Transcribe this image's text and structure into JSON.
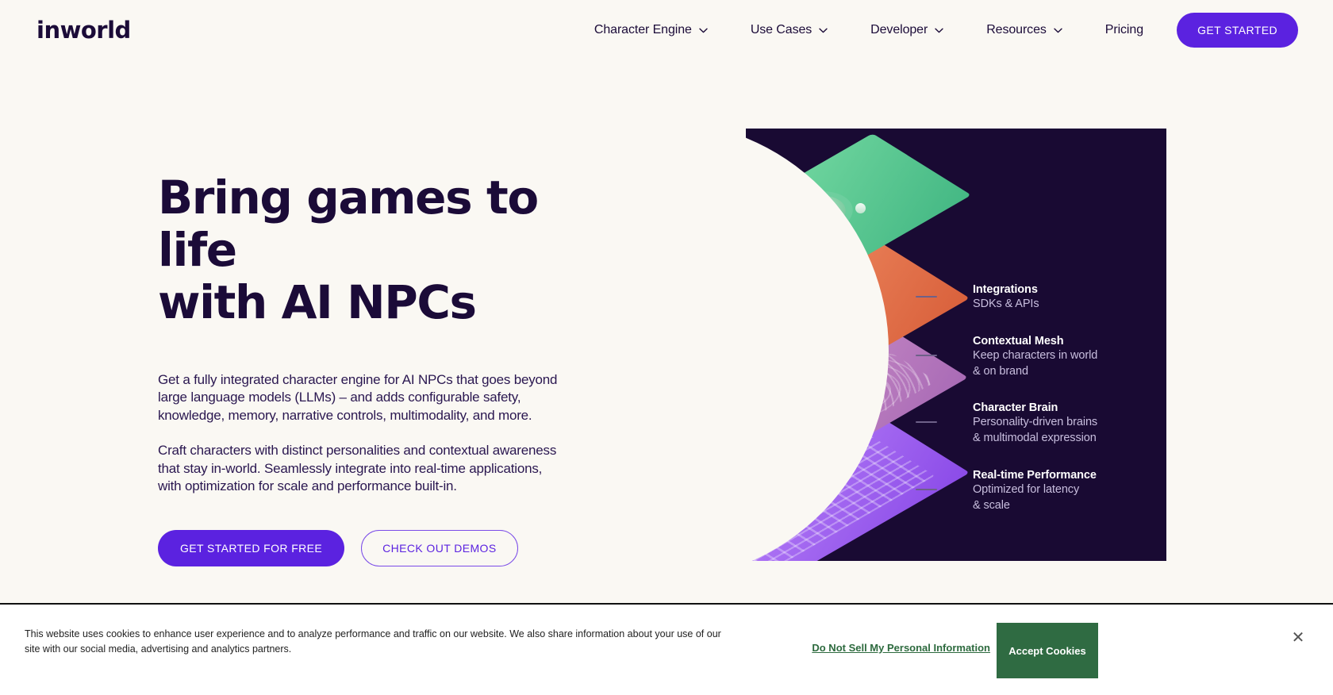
{
  "brand": {
    "logo_text": "inworld",
    "accent": "#5B22E0",
    "dark": "#1B0B38",
    "bg": "#FAF8F3"
  },
  "header": {
    "nav": [
      {
        "label": "Character Engine",
        "has_dropdown": true,
        "icon": "chevron-down-icon"
      },
      {
        "label": "Use Cases",
        "has_dropdown": true,
        "icon": "chevron-down-icon"
      },
      {
        "label": "Developer",
        "has_dropdown": true,
        "icon": "chevron-down-icon"
      },
      {
        "label": "Resources",
        "has_dropdown": true,
        "icon": "chevron-down-icon"
      },
      {
        "label": "Pricing",
        "has_dropdown": false,
        "icon": ""
      }
    ],
    "cta_label": "GET STARTED"
  },
  "hero": {
    "headline_line1": "Bring games to life",
    "headline_line2": "with AI NPCs",
    "paragraph1": "Get a fully integrated character engine for AI NPCs that goes beyond large language models (LLMs) – and adds configurable safety, knowledge, memory, narrative controls, multimodality, and more.",
    "paragraph2": "Craft characters with distinct personalities and contextual awareness that stay in-world. Seamlessly integrate into real-time applications, with optimization for scale and performance built-in.",
    "primary_cta": "GET STARTED FOR FREE",
    "secondary_cta": "CHECK OUT DEMOS"
  },
  "graphic": {
    "panel_bg": "#190A33",
    "layers": [
      {
        "name": "integrations-layer",
        "color": "#4FC78C"
      },
      {
        "name": "contextual-layer",
        "color": "#E5794F"
      },
      {
        "name": "brain-layer",
        "color": "#BE83C4"
      },
      {
        "name": "performance-layer",
        "color": "#A767F2"
      }
    ],
    "features": [
      {
        "title": "Integrations",
        "desc_line1": "SDKs & APIs",
        "desc_line2": ""
      },
      {
        "title": "Contextual Mesh",
        "desc_line1": "Keep characters in world",
        "desc_line2": "& on brand"
      },
      {
        "title": "Character Brain",
        "desc_line1": "Personality-driven brains",
        "desc_line2": "& multimodal expression"
      },
      {
        "title": "Real-time Performance",
        "desc_line1": "Optimized for latency",
        "desc_line2": "& scale"
      }
    ]
  },
  "cookie_banner": {
    "text": "This website uses cookies to enhance user experience and to analyze performance and traffic on our website. We also share information about your use of our site with our social media, advertising and analytics partners.",
    "link_label": "Do Not Sell My Personal Information",
    "accept_label": "Accept Cookies",
    "close_glyph": "✕",
    "accent": "#2F6B42"
  }
}
